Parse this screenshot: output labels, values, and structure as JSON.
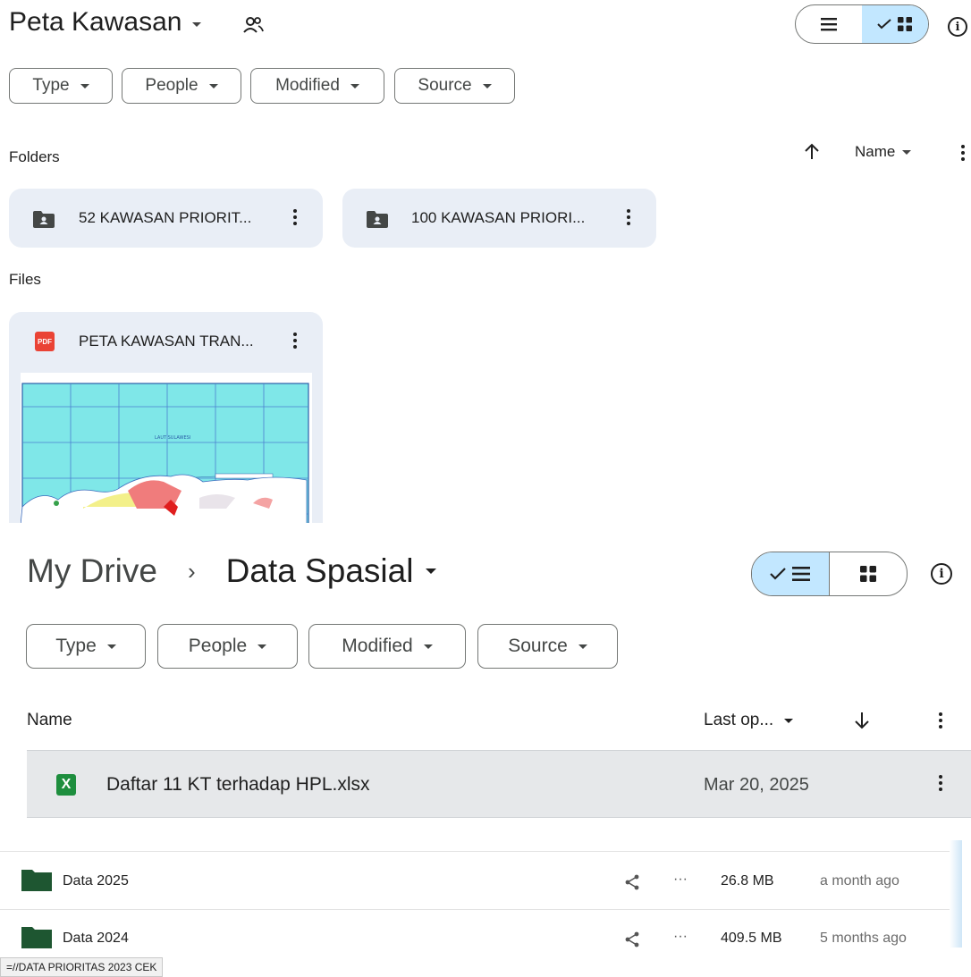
{
  "top_panel": {
    "title": "Peta Kawasan",
    "icons": {
      "shared": "people-icon",
      "list_view": "list-icon",
      "grid_view": "grid-icon",
      "info": "info-icon"
    },
    "filters": [
      "Type",
      "People",
      "Modified",
      "Source"
    ],
    "folders_label": "Folders",
    "sort_label": "Name",
    "folders": [
      "52 KAWASAN PRIORIT...",
      "100 KAWASAN PRIORI..."
    ],
    "files_label": "Files",
    "files": [
      {
        "name": "PETA KAWASAN TRAN...",
        "type_badge": "PDF",
        "map_label": "LAUT SULAWESI"
      }
    ]
  },
  "middle_panel": {
    "breadcrumb_root": "My Drive",
    "breadcrumb_separator": "›",
    "current_folder": "Data Spasial",
    "filters": [
      "Type",
      "People",
      "Modified",
      "Source"
    ],
    "column_name": "Name",
    "column_sort": "Last op...",
    "rows": [
      {
        "name": "Daftar 11 KT terhadap HPL.xlsx",
        "icon": "X",
        "last_opened": "Mar 20, 2025"
      }
    ]
  },
  "bottom_panel": {
    "rows": [
      {
        "name": "Data 2025",
        "share_icon": "share-icon",
        "more": "···",
        "size": "26.8 MB",
        "modified": "a month ago"
      },
      {
        "name": "Data 2024",
        "share_icon": "share-icon",
        "more": "···",
        "size": "409.5 MB",
        "modified": "5 months ago"
      }
    ],
    "status": "=//DATA PRIORITAS 2023 CEK"
  },
  "colors": {
    "card_bg": "#e9eef6",
    "selected_toggle": "#c2e7ff",
    "folder_dark_green": "#1e5631",
    "pdf_red": "#ea4335",
    "xlsx_green": "#1e8e3e"
  }
}
